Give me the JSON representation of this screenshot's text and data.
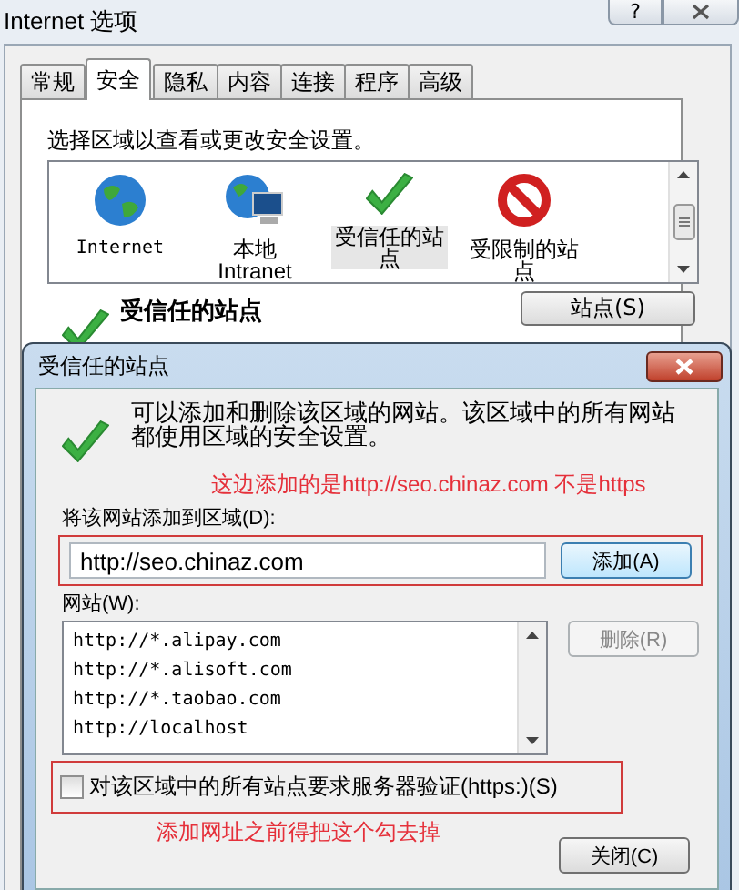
{
  "window": {
    "title": "Internet 选项",
    "help": "?"
  },
  "tabs": [
    {
      "label": "常规",
      "selected": false
    },
    {
      "label": "安全",
      "selected": true
    },
    {
      "label": "隐私",
      "selected": false
    },
    {
      "label": "内容",
      "selected": false
    },
    {
      "label": "连接",
      "selected": false
    },
    {
      "label": "程序",
      "selected": false
    },
    {
      "label": "高级",
      "selected": false
    }
  ],
  "security": {
    "instruction": "选择区域以查看或更改安全设置。",
    "zones": [
      {
        "label": "Internet",
        "kind": "globe",
        "selected": false
      },
      {
        "label": "本地 Intranet",
        "kind": "intranet",
        "selected": false
      },
      {
        "label": "受信任的站点",
        "kind": "trusted",
        "selected": true
      },
      {
        "label": "受限制的站点",
        "kind": "restricted",
        "selected": false
      }
    ],
    "zone_title": "受信任的站点",
    "sites_button": "站点(S)"
  },
  "dialog": {
    "title": "受信任的站点",
    "info": "可以添加和删除该区域的网站。该区域中的所有网站都使用区域的安全设置。",
    "annotation_top": "这边添加的是http://seo.chinaz.com 不是https",
    "add_label": "将该网站添加到区域(D):",
    "url_value": "http://seo.chinaz.com",
    "add_button": "添加(A)",
    "sites_label": "网站(W):",
    "sites": [
      "http://*.alipay.com",
      "http://*.alisoft.com",
      "http://*.taobao.com",
      "http://localhost"
    ],
    "remove_button": {
      "label": "删除(R)",
      "disabled": true
    },
    "https_checkbox": {
      "label": "对该区域中的所有站点要求服务器验证(https:)(S)",
      "checked": false
    },
    "annotation_bottom": "添加网址之前得把这个勾去掉",
    "close_button": "关闭(C)"
  }
}
